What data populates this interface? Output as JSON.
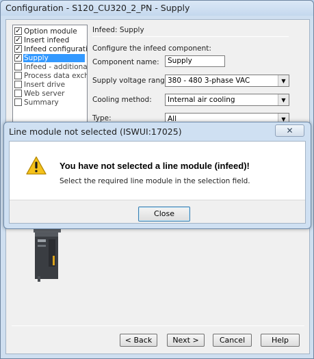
{
  "window": {
    "title": "Configuration - S120_CU320_2_PN - Supply"
  },
  "nav": {
    "items": [
      {
        "label": "Option module",
        "checked": true
      },
      {
        "label": "Insert infeed",
        "checked": true
      },
      {
        "label": "Infeed configuration",
        "checked": true
      },
      {
        "label": "Supply",
        "checked": true,
        "selected": true
      },
      {
        "label": "Infeed - additional",
        "checked": false
      },
      {
        "label": "Process data exchange",
        "checked": false
      },
      {
        "label": "Insert drive",
        "checked": false
      },
      {
        "label": "Web server",
        "checked": false
      },
      {
        "label": "Summary",
        "checked": false
      }
    ]
  },
  "form": {
    "heading": "Infeed: Supply",
    "caption": "Configure the infeed component:",
    "component_name_label": "Component name:",
    "component_name_value": "Supply",
    "voltage_label": "Supply voltage range:",
    "voltage_value": "380 - 480 3-phase VAC",
    "cooling_label": "Cooling method:",
    "cooling_value": "Internal air cooling",
    "type_label": "Type:",
    "type_value": "All"
  },
  "buttons": {
    "back": "< Back",
    "next": "Next >",
    "cancel": "Cancel",
    "help": "Help"
  },
  "dialog": {
    "title": "Line module not selected (ISWUI:17025)",
    "close_icon": "✕",
    "heading": "You have not selected a line module (infeed)!",
    "message": "Select the required line module in the selection field.",
    "close_button": "Close"
  },
  "icons": {
    "warning": "warning-icon",
    "checkbox_check": "✓",
    "dropdown": "▼"
  },
  "colors": {
    "selection": "#3399ff",
    "warning_fill": "#f5c21b",
    "title_bar": "#cfdff0"
  }
}
